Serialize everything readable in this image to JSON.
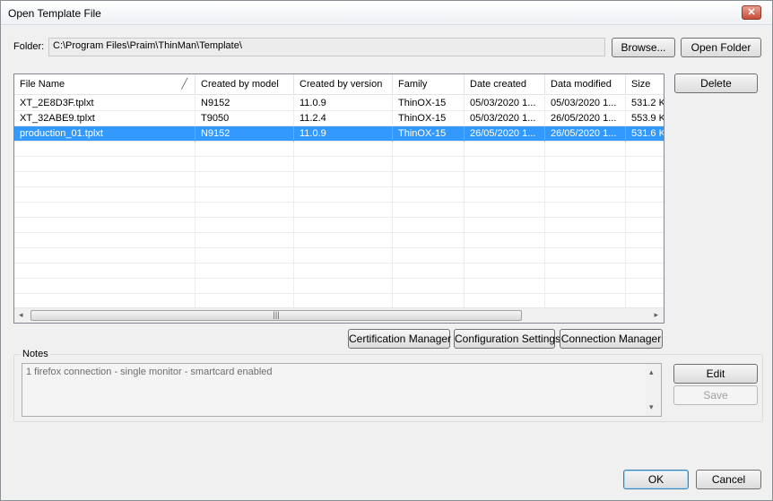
{
  "window": {
    "title": "Open Template File",
    "close_glyph": "✕"
  },
  "folder": {
    "label": "Folder:",
    "path": "C:\\Program Files\\Praim\\ThinMan\\Template\\",
    "browse_label": "Browse...",
    "open_folder_label": "Open Folder"
  },
  "table": {
    "columns": [
      "File Name",
      "Created by model",
      "Created by version",
      "Family",
      "Date created",
      "Data modified",
      "Size"
    ],
    "rows": [
      [
        "XT_2E8D3F.tplxt",
        "N9152",
        "11.0.9",
        "ThinOX-15",
        "05/03/2020 1...",
        "05/03/2020 1...",
        "531.2 K"
      ],
      [
        "XT_32ABE9.tplxt",
        "T9050",
        "11.2.4",
        "ThinOX-15",
        "05/03/2020 1...",
        "26/05/2020 1...",
        "553.9 K"
      ],
      [
        "production_01.tplxt",
        "N9152",
        "11.0.9",
        "ThinOX-15",
        "26/05/2020 1...",
        "26/05/2020 1...",
        "531.6 K"
      ]
    ],
    "selected_row": 2,
    "selection_color": "#3399ff"
  },
  "buttons": {
    "delete": "Delete",
    "certification_manager": "Certification Manager",
    "configuration_settings": "Configuration Settings",
    "connection_manager": "Connection Manager",
    "edit": "Edit",
    "save": "Save",
    "ok": "OK",
    "cancel": "Cancel"
  },
  "notes": {
    "label": "Notes",
    "text": "1 firefox connection  - single monitor - smartcard enabled"
  },
  "icons": {
    "sort": "sort-indicator-icon",
    "scroll_left": "◂",
    "scroll_right": "▸",
    "scroll_up": "▴",
    "scroll_down": "▾",
    "grip": "|||"
  }
}
